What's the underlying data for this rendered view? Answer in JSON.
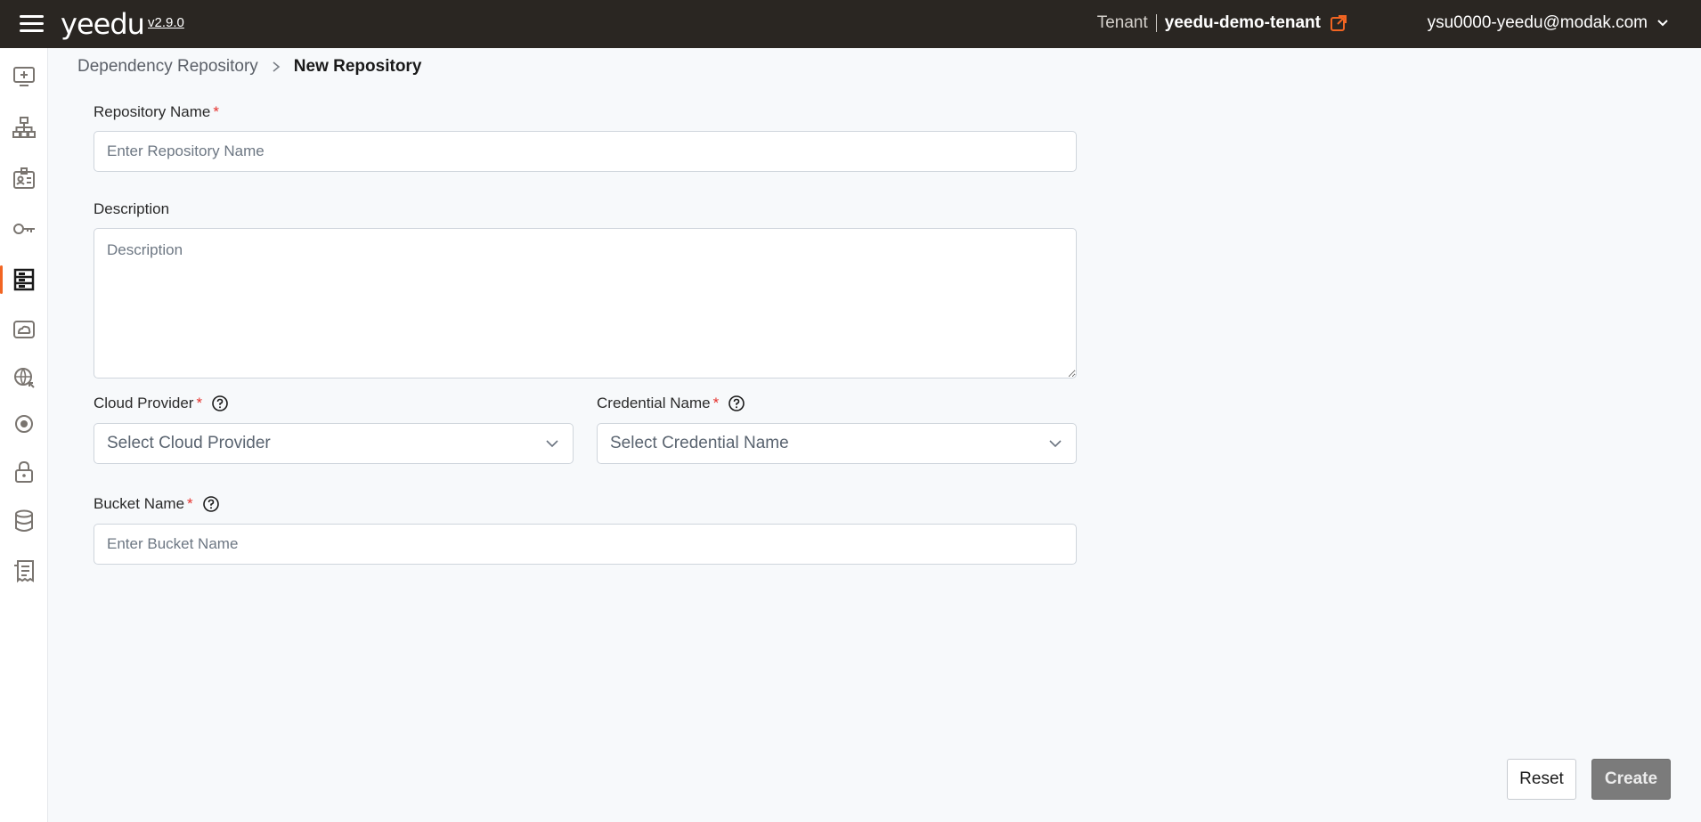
{
  "header": {
    "logo": "yeedu",
    "version": "v2.9.0",
    "tenant_label": "Tenant",
    "tenant_name": "yeedu-demo-tenant",
    "user_email": "ysu0000-yeedu@modak.com"
  },
  "sidebar": {
    "items": [
      {
        "icon": "add-screen-icon"
      },
      {
        "icon": "sitemap-icon"
      },
      {
        "icon": "id-badge-icon"
      },
      {
        "icon": "key-icon"
      },
      {
        "icon": "repository-icon",
        "active": true
      },
      {
        "icon": "cloud-panel-icon"
      },
      {
        "icon": "globe-icon"
      },
      {
        "icon": "target-icon"
      },
      {
        "icon": "lock-icon"
      },
      {
        "icon": "database-icon"
      },
      {
        "icon": "receipt-icon"
      }
    ]
  },
  "breadcrumb": {
    "parent": "Dependency Repository",
    "current": "New Repository"
  },
  "form": {
    "repository_name": {
      "label": "Repository Name",
      "placeholder": "Enter Repository Name",
      "value": ""
    },
    "description": {
      "label": "Description",
      "placeholder": "Description",
      "value": ""
    },
    "cloud_provider": {
      "label": "Cloud Provider",
      "selected": "Select Cloud Provider"
    },
    "credential_name": {
      "label": "Credential Name",
      "selected": "Select Credential Name"
    },
    "bucket_name": {
      "label": "Bucket Name",
      "placeholder": "Enter Bucket Name",
      "value": ""
    },
    "required_mark": "*"
  },
  "actions": {
    "reset_label": "Reset",
    "create_label": "Create"
  },
  "colors": {
    "header_bg": "#2a2622",
    "accent": "#f26522",
    "required": "#e5322d",
    "create_disabled": "#7b7b7b"
  }
}
